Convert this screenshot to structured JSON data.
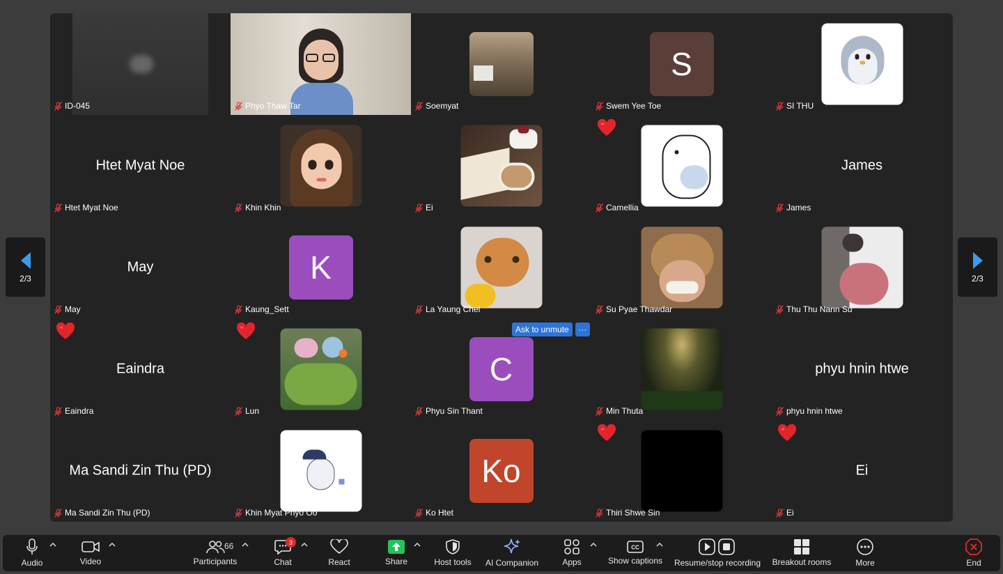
{
  "colors": {
    "tile_bg": "#232323",
    "toolbar_bg": "#1c1c1c",
    "accent_blue": "#2d74da",
    "mute_red": "#e02828",
    "share_green": "#23c35a"
  },
  "pagination": {
    "left_label": "2/3",
    "right_label": "2/3"
  },
  "unmute_popup": {
    "label": "Ask to unmute",
    "more": "···"
  },
  "tiles": [
    {
      "name": "ID-045",
      "center": "",
      "type": "video-blur",
      "heart": false
    },
    {
      "name": "Phyo Thaw Tar",
      "center": "",
      "type": "video-avatar",
      "heart": false
    },
    {
      "name": "Soemyat",
      "center": "",
      "type": "photo-small",
      "heart": false
    },
    {
      "name": "Swem Yee Toe",
      "center": "",
      "letter": "S",
      "letter_color": "#5a3e37",
      "type": "letter",
      "heart": false
    },
    {
      "name": "SI THU",
      "center": "",
      "type": "penguin",
      "heart": false
    },
    {
      "name": "Htet Myat Noe",
      "center": "Htet Myat Noe",
      "type": "text",
      "heart": false
    },
    {
      "name": "Khin Khin",
      "center": "",
      "type": "girl",
      "heart": false
    },
    {
      "name": "Ei",
      "center": "",
      "type": "coffee",
      "heart": false
    },
    {
      "name": "Camellia",
      "center": "",
      "type": "cat-cartoon",
      "heart": true
    },
    {
      "name": "James",
      "center": "James",
      "type": "text",
      "heart": false
    },
    {
      "name": "May",
      "center": "May",
      "type": "text",
      "heart": false
    },
    {
      "name": "Kaung_Sett",
      "center": "",
      "letter": "K",
      "letter_color": "#9b4dbd",
      "type": "letter",
      "heart": false
    },
    {
      "name": "La Yaung Chel",
      "center": "",
      "type": "cat-orange",
      "heart": false
    },
    {
      "name": "Su Pyae Thawdar",
      "center": "",
      "type": "bear",
      "heart": false
    },
    {
      "name": "Thu Thu Nann Su",
      "center": "",
      "type": "cat-white",
      "heart": false
    },
    {
      "name": "Eaindra",
      "center": "Eaindra",
      "type": "text",
      "heart": true
    },
    {
      "name": "Lun",
      "center": "",
      "type": "plants",
      "heart": true
    },
    {
      "name": "Phyu Sin Thant",
      "center": "",
      "letter": "C",
      "letter_color": "#9b4dbd",
      "type": "letter",
      "heart": false
    },
    {
      "name": "Min Thuta",
      "center": "",
      "type": "forest",
      "heart": false
    },
    {
      "name": "phyu hnin htwe",
      "center": "phyu hnin htwe",
      "type": "text",
      "heart": false
    },
    {
      "name": "Ma Sandi Zin Thu (PD)",
      "center": "Ma Sandi Zin Thu (PD)",
      "type": "text",
      "heart": false
    },
    {
      "name": "Khin Myat Phyo Oo",
      "center": "",
      "type": "totoro",
      "heart": false
    },
    {
      "name": "Ko Htet",
      "center": "",
      "letter": "Ko",
      "letter_color": "#c0452a",
      "type": "letter",
      "heart": false
    },
    {
      "name": "Thiri Shwe Sin",
      "center": "",
      "type": "black",
      "heart": true
    },
    {
      "name": "Ei",
      "center": "Ei",
      "type": "text",
      "heart": true
    }
  ],
  "toolbar": {
    "audio": "Audio",
    "video": "Video",
    "participants": "Participants",
    "participants_count": "66",
    "chat": "Chat",
    "chat_badge": "3",
    "react": "React",
    "share": "Share",
    "host_tools": "Host tools",
    "ai_companion": "AI Companion",
    "apps": "Apps",
    "show_captions": "Show captions",
    "recording": "Resume/stop recording",
    "breakout": "Breakout rooms",
    "more": "More",
    "end": "End"
  }
}
